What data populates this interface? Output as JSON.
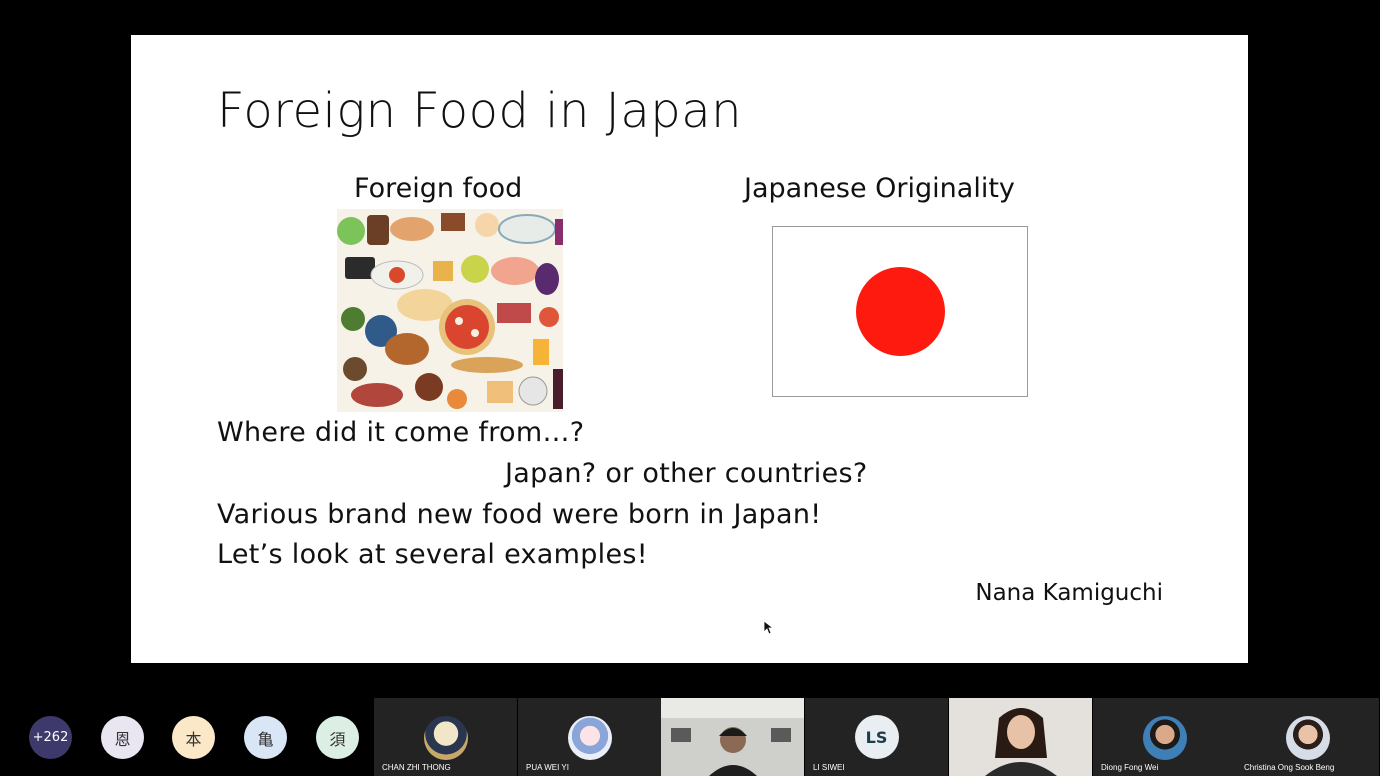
{
  "slide": {
    "title": "Foreign Food in Japan",
    "heading_left": "Foreign food",
    "heading_right": "Japanese Originality",
    "lines": [
      "Where did it come from…?",
      "Japan? or other countries?",
      "Various brand new food were born in Japan!",
      "Let’s look at several examples!"
    ],
    "author": "Nana Kamiguchi",
    "flag_disc_color": "#ff1a0f"
  },
  "participants": {
    "more_count": "+262",
    "bubbles": [
      "恩",
      "本",
      "亀",
      "須"
    ],
    "tiles": [
      {
        "name": "CHAN ZHI THONG"
      },
      {
        "name": "PUA WEI YI"
      },
      {
        "name": ""
      },
      {
        "name": "LI SIWEI",
        "initials": "LS"
      },
      {
        "name": ""
      },
      {
        "name": "Diong Fong Wei"
      },
      {
        "name": "Christina Ong Sook Beng"
      }
    ]
  }
}
